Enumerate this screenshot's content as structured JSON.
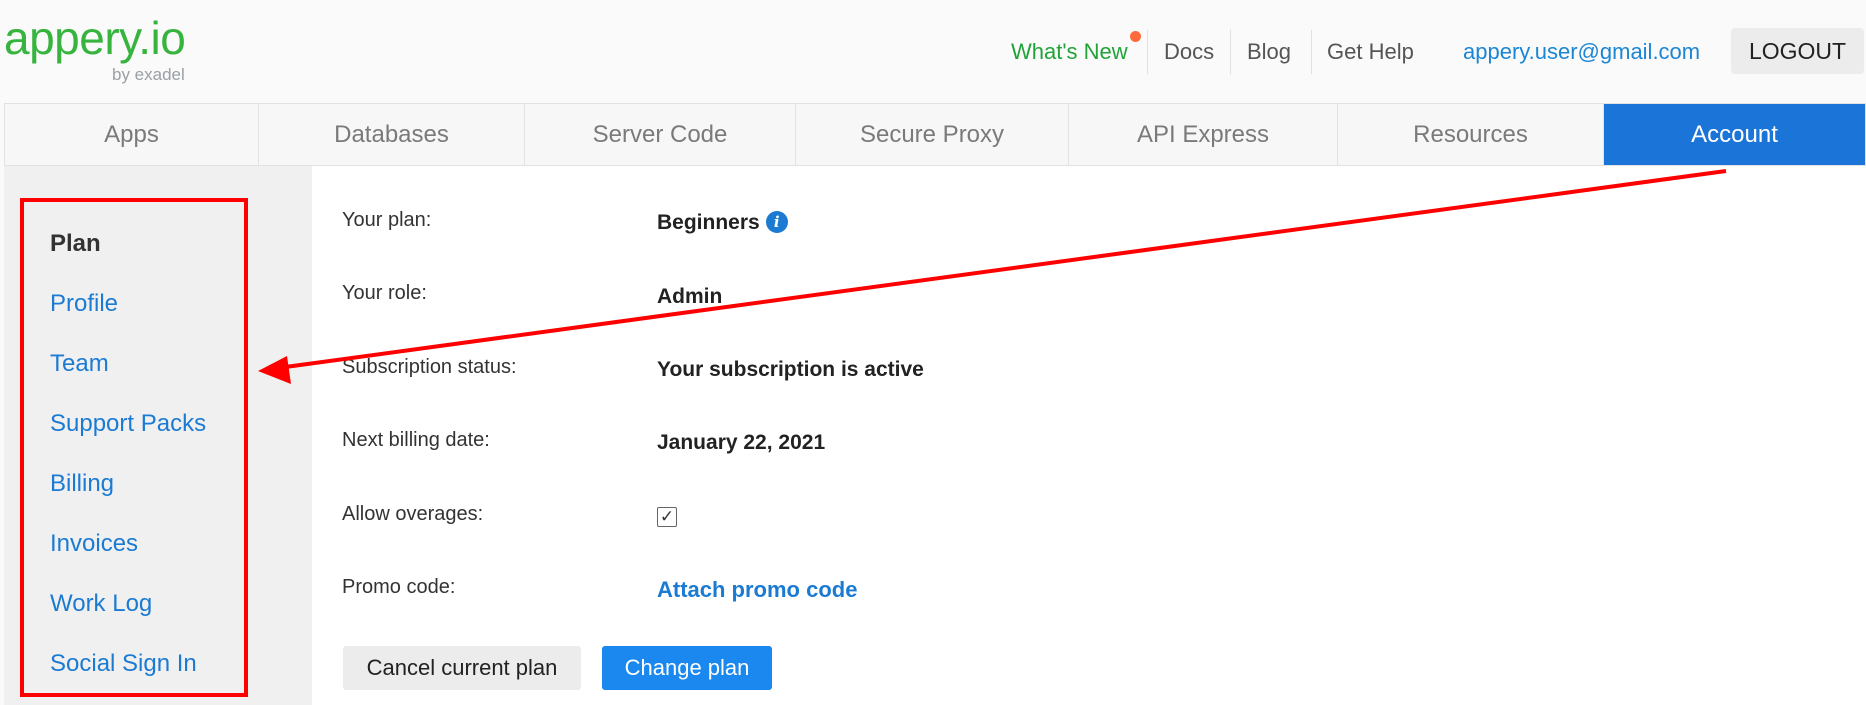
{
  "logo": {
    "text": "appery.io",
    "sub": "by exadel"
  },
  "header": {
    "whats_new": "What's New",
    "docs": "Docs",
    "blog": "Blog",
    "get_help": "Get Help",
    "email": "appery.user@gmail.com",
    "logout": "LOGOUT"
  },
  "tabs": [
    {
      "label": "Apps"
    },
    {
      "label": "Databases"
    },
    {
      "label": "Server Code"
    },
    {
      "label": "Secure Proxy"
    },
    {
      "label": "API Express"
    },
    {
      "label": "Resources"
    },
    {
      "label": "Account",
      "active": true
    }
  ],
  "sidebar": {
    "items": [
      {
        "label": "Plan",
        "current": true
      },
      {
        "label": "Profile"
      },
      {
        "label": "Team"
      },
      {
        "label": "Support Packs"
      },
      {
        "label": "Billing"
      },
      {
        "label": "Invoices"
      },
      {
        "label": "Work Log"
      },
      {
        "label": "Social Sign In"
      }
    ]
  },
  "plan": {
    "your_plan_label": "Your plan:",
    "your_plan_value": "Beginners",
    "role_label": "Your role:",
    "role_value": "Admin",
    "subscription_label": "Subscription status:",
    "subscription_value": "Your subscription is active",
    "billing_label": "Next billing date:",
    "billing_value": "January 22, 2021",
    "overages_label": "Allow overages:",
    "overages_checked": true,
    "promo_label": "Promo code:",
    "promo_link": "Attach promo code",
    "cancel_button": "Cancel current plan",
    "change_button": "Change plan"
  },
  "icons": {
    "info": "info-icon",
    "check": "checkmark-icon"
  },
  "colors": {
    "brand_green": "#36b43e",
    "accent_blue": "#1b74d8",
    "link_blue": "#1b7bd3",
    "annotation_red": "#ff0000",
    "notification": "#ff6a3d"
  }
}
